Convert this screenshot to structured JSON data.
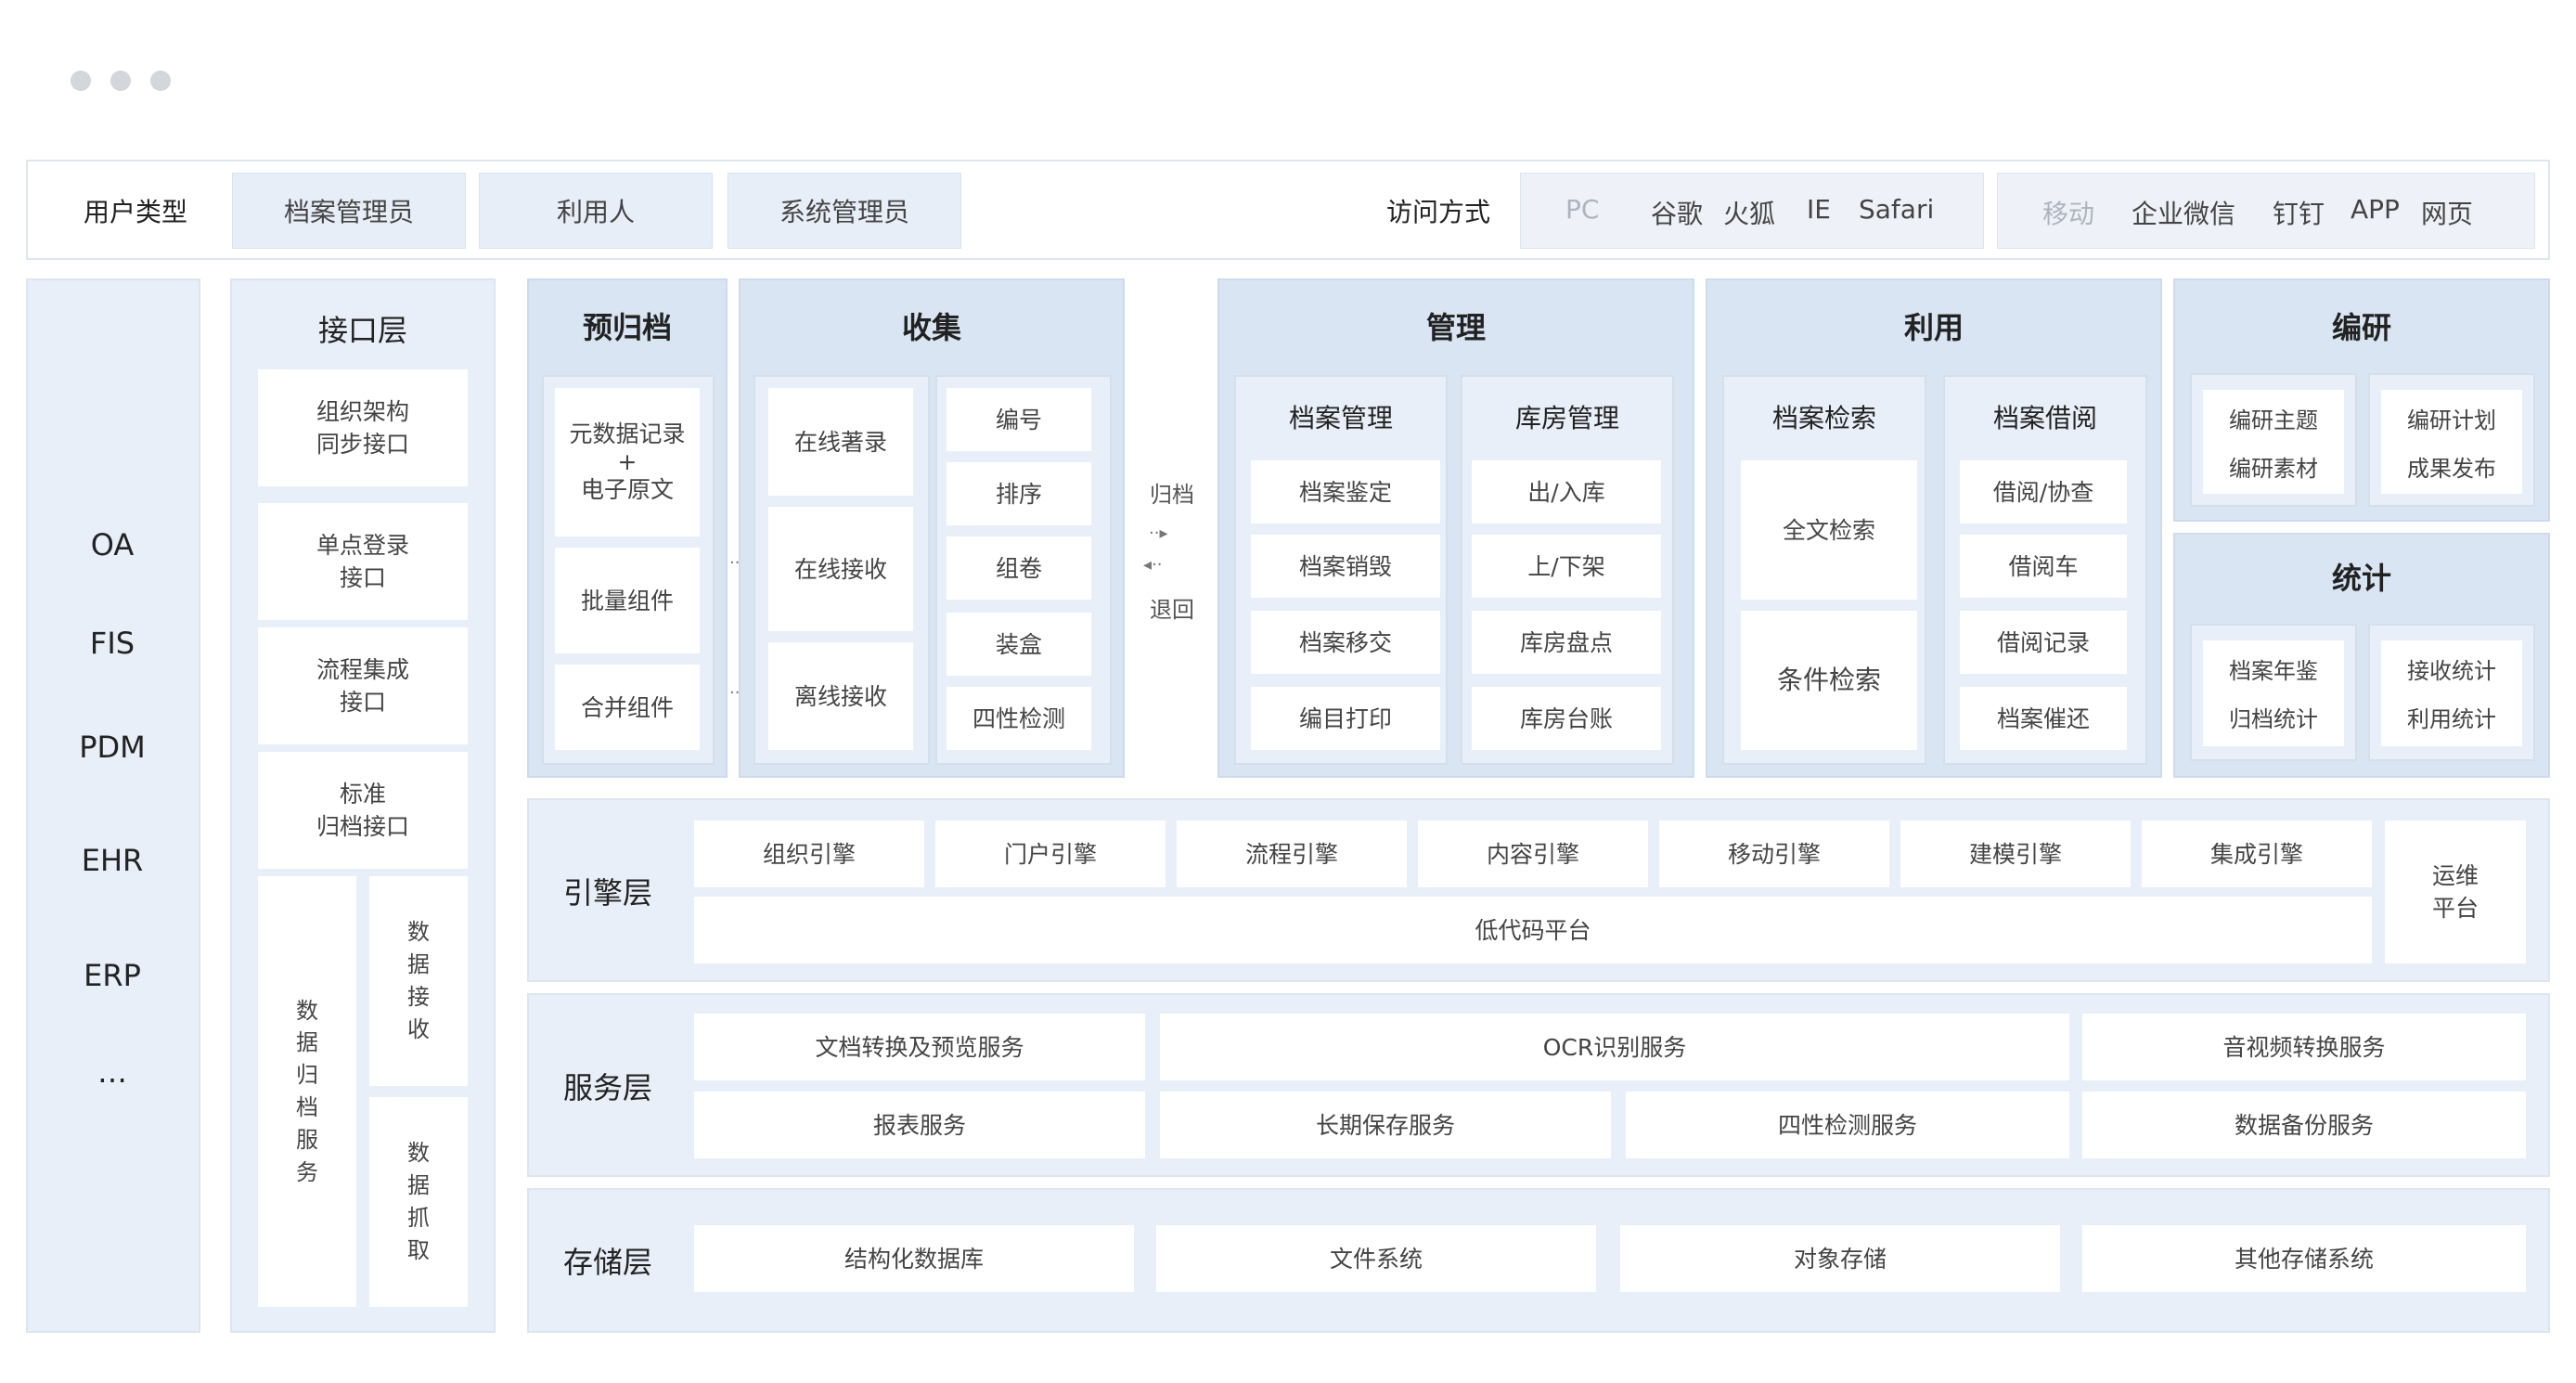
{
  "header": {
    "user_type_label": "用户类型",
    "user_types": [
      "档案管理员",
      "利用人",
      "系统管理员"
    ],
    "access_label": "访问方式",
    "pc_group": {
      "title": "PC",
      "items": [
        "谷歌",
        "火狐",
        "IE",
        "Safari"
      ]
    },
    "mobile_group": {
      "title": "移动",
      "items": [
        "企业微信",
        "钉钉",
        "APP",
        "网页"
      ]
    }
  },
  "systems": [
    "OA",
    "FIS",
    "PDM",
    "EHR",
    "ERP",
    "…"
  ],
  "interface_layer": {
    "title": "接口层",
    "items": [
      "组织架构\n同步接口",
      "单点登录\n接口",
      "流程集成\n接口",
      "标准\n归档接口"
    ],
    "vertical_main": "数据归档服务",
    "vertical_sub": [
      "数据接收",
      "数据抓取"
    ]
  },
  "pre_archive": {
    "title": "预归档",
    "items": [
      "元数据记录\n+\n电子原文",
      "批量组件",
      "合并组件"
    ]
  },
  "collect": {
    "title": "收集",
    "left_items": [
      "在线著录",
      "在线接收",
      "离线接收"
    ],
    "right_items": [
      "编号",
      "排序",
      "组卷",
      "装盒",
      "四性检测"
    ]
  },
  "flow": {
    "forward": "归档",
    "back": "退回"
  },
  "manage": {
    "title": "管理",
    "groups": [
      {
        "title": "档案管理",
        "items": [
          "档案鉴定",
          "档案销毁",
          "档案移交",
          "编目打印"
        ]
      },
      {
        "title": "库房管理",
        "items": [
          "出/入库",
          "上/下架",
          "库房盘点",
          "库房台账"
        ]
      }
    ]
  },
  "use": {
    "title": "利用",
    "groups": [
      {
        "title": "档案检索",
        "items": [
          "全文检索",
          "条件检索"
        ]
      },
      {
        "title": "档案借阅",
        "items": [
          "借阅/协查",
          "借阅车",
          "借阅记录",
          "档案催还"
        ]
      }
    ]
  },
  "research": {
    "title": "编研",
    "items": [
      "编研主题",
      "编研素材",
      "编研计划",
      "成果发布"
    ]
  },
  "stats": {
    "title": "统计",
    "items": [
      "档案年鉴",
      "归档统计",
      "接收统计",
      "利用统计"
    ]
  },
  "engine_layer": {
    "title": "引擎层",
    "items": [
      "组织引擎",
      "门户引擎",
      "流程引擎",
      "内容引擎",
      "移动引擎",
      "建模引擎",
      "集成引擎"
    ],
    "lowcode": "低代码平台",
    "ops": "运维\n平台"
  },
  "service_layer": {
    "title": "服务层",
    "row1": [
      "文档转换及预览服务",
      "OCR识别服务",
      "音视频转换服务"
    ],
    "row2": [
      "报表服务",
      "长期保存服务",
      "四性检测服务",
      "数据备份服务"
    ]
  },
  "storage_layer": {
    "title": "存储层",
    "items": [
      "结构化数据库",
      "文件系统",
      "对象存储",
      "其他存储系统"
    ]
  }
}
